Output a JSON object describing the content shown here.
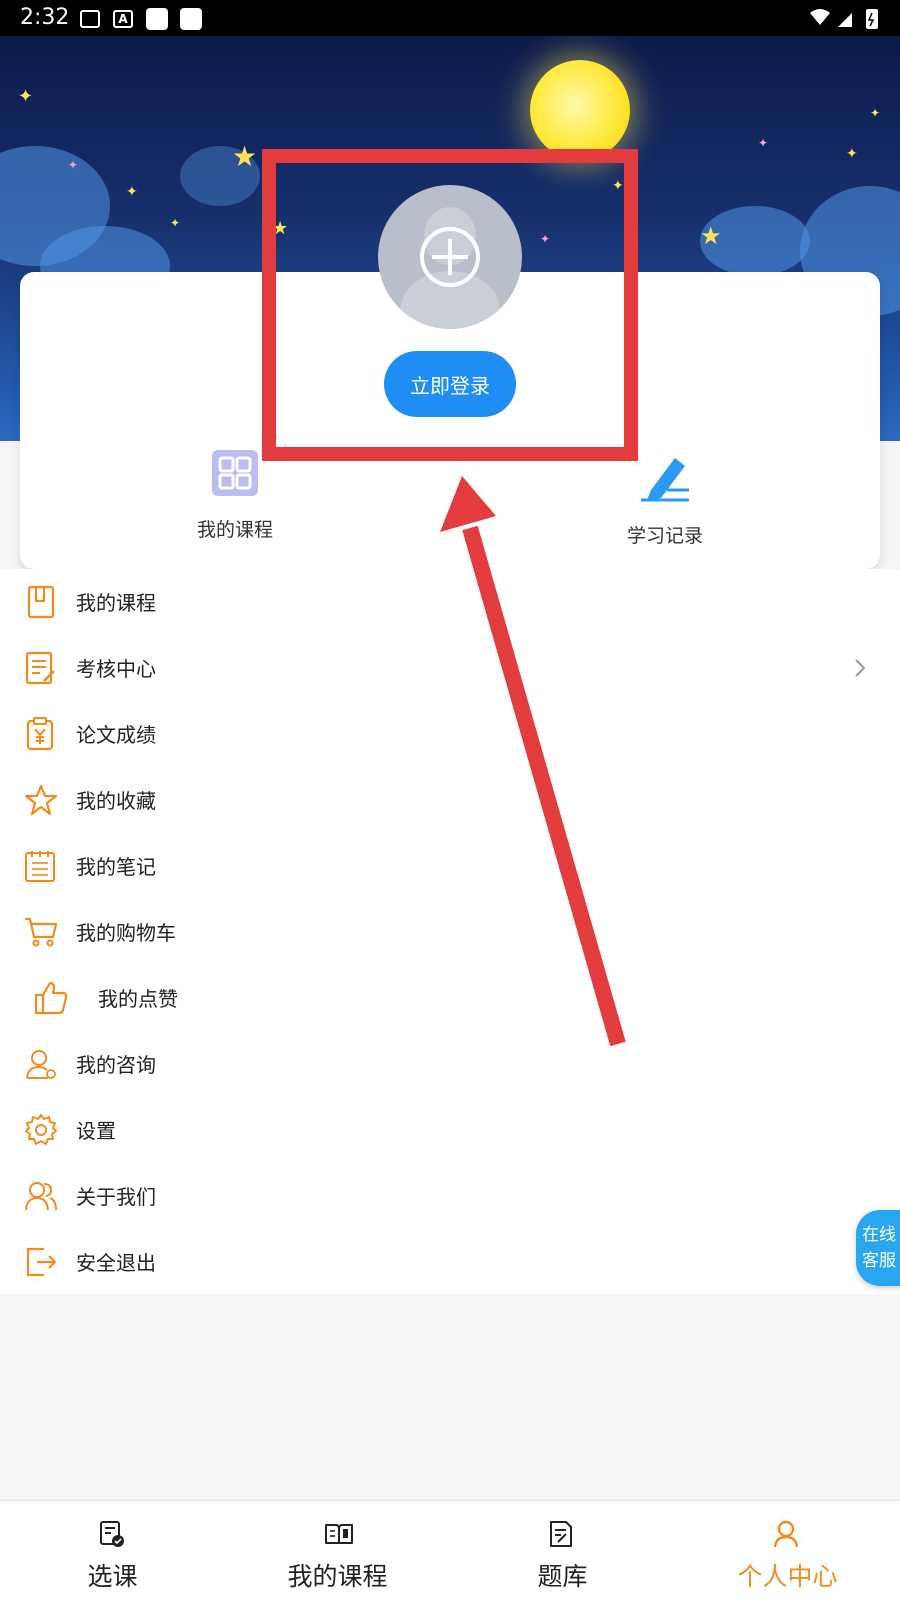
{
  "status_bar": {
    "time": "2:32",
    "font_icon_letter": "A"
  },
  "card": {
    "login_button": "立即登录",
    "quick_actions": [
      {
        "label": "我的课程",
        "icon": "grid-icon"
      },
      {
        "label": "学习记录",
        "icon": "pen-icon"
      }
    ]
  },
  "menu": [
    {
      "label": "我的课程",
      "icon": "notebook-icon"
    },
    {
      "label": "考核中心",
      "icon": "clipboard-edit-icon"
    },
    {
      "label": "论文成绩",
      "icon": "yen-receipt-icon"
    },
    {
      "label": "我的收藏",
      "icon": "star-icon"
    },
    {
      "label": "我的笔记",
      "icon": "notepad-icon"
    },
    {
      "label": "我的购物车",
      "icon": "cart-icon"
    },
    {
      "label": "我的点赞",
      "icon": "thumbs-up-icon"
    },
    {
      "label": "我的咨询",
      "icon": "user-chat-icon"
    },
    {
      "label": "设置",
      "icon": "gear-icon"
    },
    {
      "label": "关于我们",
      "icon": "people-icon"
    },
    {
      "label": "安全退出",
      "icon": "logout-icon"
    }
  ],
  "float_service": {
    "line1": "在线",
    "line2": "客服"
  },
  "bottom_nav": [
    {
      "label": "选课",
      "icon": "select-course-icon",
      "active": false
    },
    {
      "label": "我的课程",
      "icon": "book-icon",
      "active": false
    },
    {
      "label": "题库",
      "icon": "question-bank-icon",
      "active": false
    },
    {
      "label": "个人中心",
      "icon": "person-icon",
      "active": true
    }
  ],
  "colors": {
    "accent": "#f28b1d",
    "primary_blue": "#1e8ef5",
    "annotation_red": "#e23c3f"
  }
}
